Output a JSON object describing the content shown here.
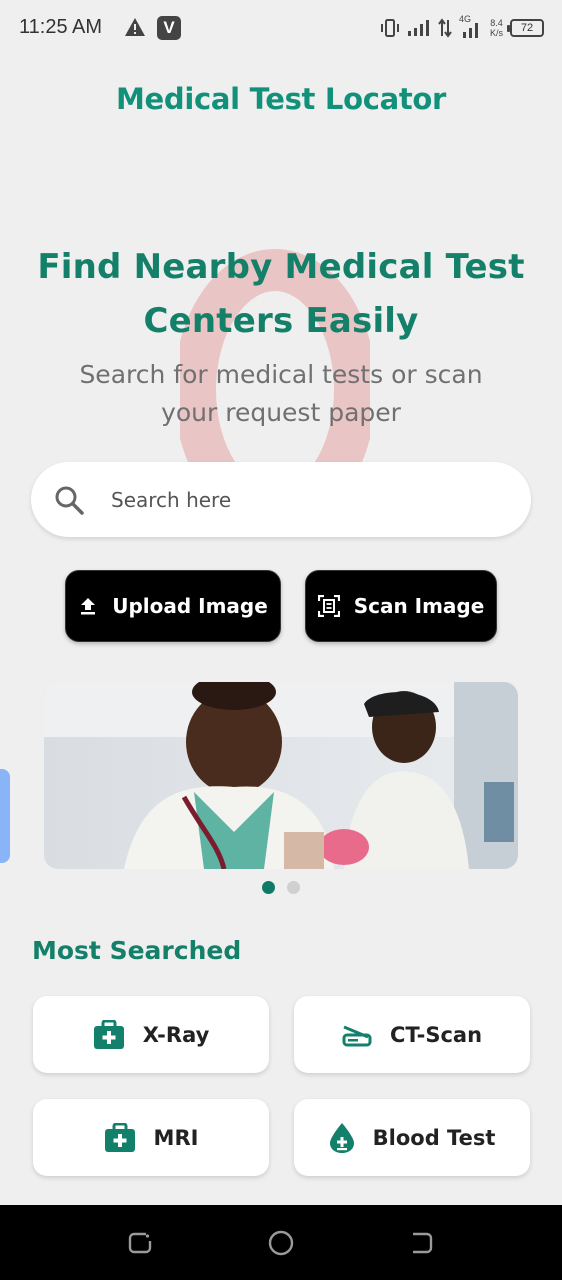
{
  "status_bar": {
    "time": "11:25 AM",
    "network_speed_value": "8.4",
    "network_speed_unit": "K/s",
    "network_type": "4G",
    "battery": "72"
  },
  "app": {
    "title": "Medical Test Locator"
  },
  "hero": {
    "title_line1": "Find Nearby Medical Test",
    "title_line2": "Centers Easily",
    "subtitle_line1": "Search for medical tests or scan",
    "subtitle_line2": "your request paper"
  },
  "search": {
    "placeholder": "Search here",
    "value": ""
  },
  "actions": {
    "upload_label": "Upload Image",
    "scan_label": "Scan Image"
  },
  "carousel": {
    "page_count": 2,
    "active_index": 0
  },
  "most_searched": {
    "title": "Most Searched",
    "items": [
      {
        "label": "X-Ray",
        "icon": "medical-kit-icon"
      },
      {
        "label": "CT-Scan",
        "icon": "scanner-icon"
      },
      {
        "label": "MRI",
        "icon": "medical-kit-icon"
      },
      {
        "label": "Blood Test",
        "icon": "blood-drop-icon"
      }
    ]
  },
  "colors": {
    "brand": "#11907a",
    "brand_dark": "#14806a",
    "button_bg": "#000000",
    "background": "#efefef"
  }
}
